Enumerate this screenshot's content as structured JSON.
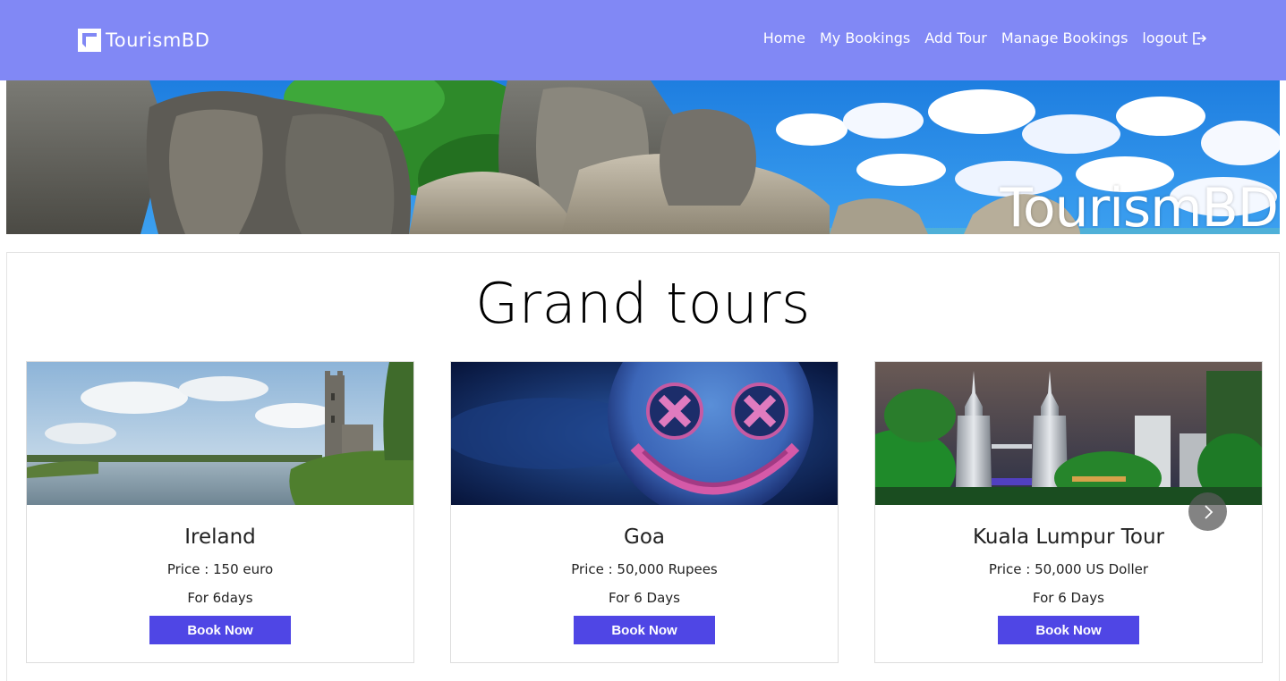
{
  "navbar": {
    "brand": "TourismBD",
    "links": [
      "Home",
      "My Bookings",
      "Add Tour",
      "Manage Bookings",
      "logout"
    ],
    "color": "#8188f5"
  },
  "hero": {
    "title": "TourismBD"
  },
  "section": {
    "title": "Grand tours"
  },
  "tours": [
    {
      "title": "Ireland",
      "price": "Price : 150 euro",
      "days": "For 6days",
      "button": "Book Now"
    },
    {
      "title": "Goa",
      "price": "Price : 50,000 Rupees",
      "days": "For 6 Days",
      "button": "Book Now"
    },
    {
      "title": "Kuala Lumpur Tour",
      "price": "Price : 50,000 US Doller",
      "days": "For 6 Days",
      "button": "Book Now"
    }
  ],
  "icons": {
    "logo": "square-frame-logo-icon",
    "logout": "logout-icon",
    "next": "chevron-right-icon"
  },
  "colors": {
    "accent": "#4f46e5"
  }
}
